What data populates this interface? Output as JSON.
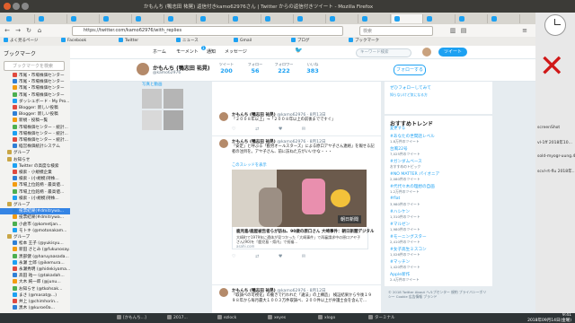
{
  "window": {
    "title": "かもんち (鴨志田 祐晃) 返信付きkamo62976さん | Twitter からの返信付きツイート - Mozilla Firefox"
  },
  "browser": {
    "url": "https://twitter.com/kamo62976/with_replies",
    "search_placeholder": "検索",
    "tab_count": 16
  },
  "bookmarks_toolbar": [
    {
      "label": "よく見るページ"
    },
    {
      "label": "Facebook"
    },
    {
      "label": "Twitter"
    },
    {
      "label": "ニュース"
    },
    {
      "label": "Gmail"
    },
    {
      "label": "ブログ"
    },
    {
      "label": "ブックマーク"
    }
  ],
  "sidebar": {
    "title": "ブックマーク",
    "search_placeholder": "ブックマークを検索",
    "items": [
      {
        "label": "市尾・市場株価センター"
      },
      {
        "label": "市尾・市場株価センター"
      },
      {
        "label": "市尾・市場株価センター"
      },
      {
        "label": "市尾・市場株価センター"
      },
      {
        "label": "ダッシュボード - My Pro..."
      },
      {
        "label": "Blogger: 新しい投稿"
      },
      {
        "label": "Blogger: 新しい投稿"
      },
      {
        "label": "新規 - 投稿一覧"
      },
      {
        "label": "市場株価センター - 統計..."
      },
      {
        "label": "市場株価センター - 統計..."
      },
      {
        "label": "市場株価センター・統計..."
      },
      {
        "label": "経営株価統計システム"
      },
      {
        "label": "グループ"
      },
      {
        "label": "お知らせ"
      },
      {
        "label": "Twitter の高度な検索"
      },
      {
        "label": "検索 - 小規模企業"
      },
      {
        "label": "検索 - (小規模)持株..."
      },
      {
        "label": "市場上位銘柄 - 最高値..."
      },
      {
        "label": "市場上位銘柄 - 最高値..."
      },
      {
        "label": "検索 - (小規模)持株..."
      },
      {
        "label": "グループ"
      },
      {
        "label": "投票結果(#dmitrywa..."
      },
      {
        "label": "投票結果(#dmitrywa..."
      },
      {
        "label": "小倉市 (@kometjan..."
      },
      {
        "label": "モトキ (@motonakam..."
      },
      {
        "label": "グループ"
      },
      {
        "label": "松本 王子 (@yukisyu..."
      },
      {
        "label": "新田 さとみ (@fukunosay..."
      },
      {
        "label": "黒部健 (@haruyaasada..."
      },
      {
        "label": "永瀬 士郎 (@ikemura..."
      },
      {
        "label": "永瀬秀明 (@hidekiyama..."
      },
      {
        "label": "高田 祐一 (@takadah..."
      },
      {
        "label": "大木 純一郎 (@junu..."
      },
      {
        "label": "お知らせ (@tkohsak..."
      },
      {
        "label": "まさ (@masat@...)"
      },
      {
        "label": "井上 (@chimhorin..."
      },
      {
        "label": "黒木 (@kuroe0a..."
      }
    ]
  },
  "twitter": {
    "nav": {
      "home": "ホーム",
      "moments": "モーメント",
      "notifications": "通知",
      "notifications_count": "1",
      "messages": "メッセージ",
      "search_placeholder": "キーワード検索",
      "tweet_button": "ツイート"
    },
    "profile": {
      "name": "かもんち (鴨志田 祐晃)",
      "handle": "@kamo62976",
      "follow_button": "フォローする",
      "stats": [
        {
          "label": "ツイート",
          "value": "200"
        },
        {
          "label": "フォロー",
          "value": "56"
        },
        {
          "label": "フォロワー",
          "value": "222"
        },
        {
          "label": "いいね",
          "value": "383"
        }
      ]
    },
    "media_label": "写真と動画",
    "tweets": [
      {
        "name": "かもんち (鴨志田 祐晃)",
        "meta": "@kamo62976 · 8月13日",
        "text": "「２００８年以上」→「２００８年以上の前後までですぐ」",
        "actions": "♡ ⇄ ♥ ✉"
      },
      {
        "name": "かもんち (鴨志田 祐晃)",
        "meta": "@kamo62976 · 8月12日",
        "text": "「安定」と呼ぶる「勤労オールスターズ」による原口アヤ子さん連絡」を報せる記者の注目を。アヤ子さん、前に訪ねた方がいいかな・・・",
        "thread": "このスレッドを表示",
        "photo_stamp": "朝日新聞",
        "card_title": "鹿児島/鹿屋被告者らが訪ね、90歳の原口さん 大崎事件：朝日新聞デジタル",
        "card_desc": "大崎町で1979年に遺体が見つかった「大崎事件」で再審請求中の原口アヤ子さん(90)を「鹿児島・県内」で祝福...",
        "card_site": "asahi.com",
        "actions": "♡ ⇄ ♥ ✉"
      },
      {
        "name": "かもんち (鴨志田 祐晃)",
        "meta": "@kamo62976 · 8月12日",
        "text": "「取調べの可視化」の動きで行われた「違法」の上構造」 検証結果から今後１９９８年から毎月最大１００３万件取調べ、２００件以上が弁護士会を含んで…",
        "name_bottom": "竹田 詩東(仮)",
        "meta_bottom": "@kamo62976 · 1年前"
      }
    ],
    "trends": {
      "title": "おすすめトレンド",
      "change": "変更する",
      "items": [
        {
          "tag": "#あなたの世間話レベル",
          "count": "1.8万件のツイート"
        },
        {
          "tag": "台風22号",
          "count": "7,025件のツイート"
        },
        {
          "tag": "#ガンダムベース",
          "count": "おすすめのトピック"
        },
        {
          "tag": "#NO MATTER パイオニア",
          "count": "2,080件のツイート"
        },
        {
          "tag": "#代代々木の理想の自画",
          "count": "1.2万件のツイート"
        },
        {
          "tag": "#flat",
          "count": "3,980件のツイート"
        },
        {
          "tag": "#ハシケン",
          "count": "1,310件のツイート"
        },
        {
          "tag": "#マルゼン",
          "count": "1,980件のツイート"
        },
        {
          "tag": "#モーニングスター",
          "count": "2,410件のツイート"
        },
        {
          "tag": "#女子高生ミスコン",
          "count": "1,026件のツイート"
        },
        {
          "tag": "#マッチン",
          "count": "1,420件のツイート"
        },
        {
          "tag": "Apple新作",
          "count": "2.4万件のツイート"
        }
      ],
      "top_items": [
        {
          "tag": "ぜひフォローしてみて"
        },
        {
          "tag": "知らないけど気になる方"
        }
      ],
      "footer": "© 2018 Twitter  About  ヘルプセンター  規約  プライバシーポリシー  Cookie  広告情報  ブランド"
    }
  },
  "desktop": {
    "window_items": [
      {
        "label": "screenShot"
      },
      {
        "label": "vl-1ff 2018年10..."
      },
      {
        "label": "sold-myogr-uung.4..."
      },
      {
        "label": "scvl-rt-flu 2018年..."
      }
    ]
  },
  "taskbar": {
    "items": [
      {
        "label": "[かもんち...]"
      },
      {
        "label": "2017..."
      },
      {
        "label": "ezlock"
      },
      {
        "label": "xeyes"
      },
      {
        "label": "xlogo"
      },
      {
        "label": "ターミナル"
      }
    ],
    "time": "9:41",
    "date": "2018年09月14日(金曜)"
  },
  "colors": {
    "twitter_blue": "#1da1f2",
    "title_bar": "#3c3b37",
    "taskbar": "#2e3436",
    "selection": "#3584e4",
    "red_x": "#d01818"
  }
}
